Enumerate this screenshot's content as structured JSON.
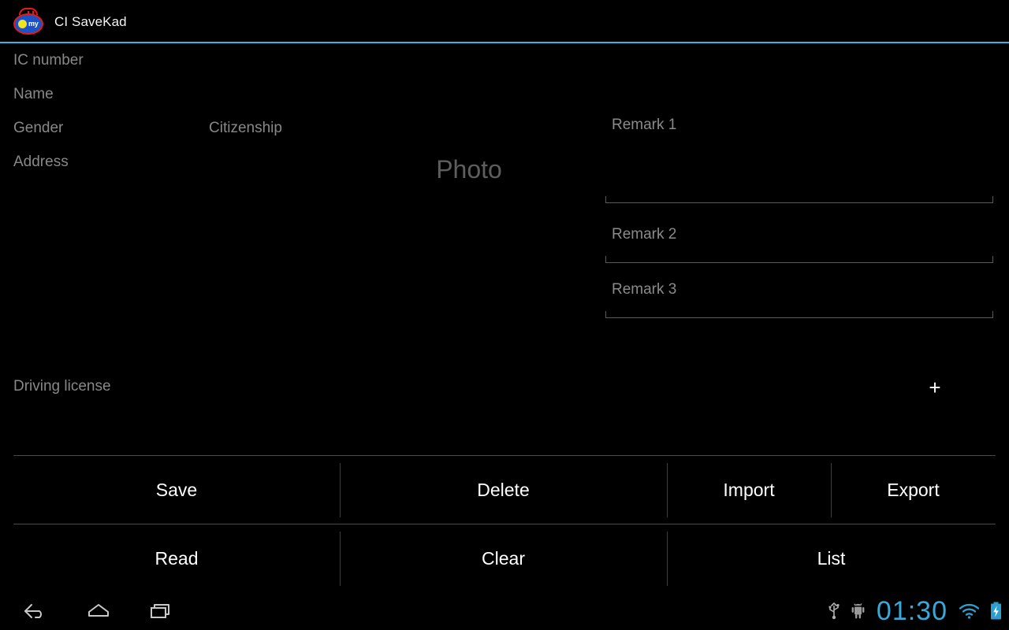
{
  "app": {
    "title": "CI SaveKad",
    "icon_name": "my-kad-logo-icon",
    "icon_badge_text": "my",
    "accent_color": "#33b5e5"
  },
  "form": {
    "ic_number_placeholder": "IC number",
    "name_placeholder": "Name",
    "gender_placeholder": "Gender",
    "citizenship_placeholder": "Citizenship",
    "address_placeholder": "Address",
    "photo_placeholder": "Photo",
    "remarks": [
      {
        "placeholder": "Remark 1",
        "value": ""
      },
      {
        "placeholder": "Remark 2",
        "value": ""
      },
      {
        "placeholder": "Remark 3",
        "value": ""
      }
    ]
  },
  "driving_license": {
    "label": "Driving license",
    "add_label": "+",
    "add_icon": "plus-icon"
  },
  "buttons": {
    "row1": [
      {
        "label": "Save"
      },
      {
        "label": "Delete"
      },
      {
        "label": "Import"
      },
      {
        "label": "Export"
      }
    ],
    "row2": [
      {
        "label": "Read"
      },
      {
        "label": "Clear"
      },
      {
        "label": "List"
      }
    ]
  },
  "navbar": {
    "back_icon": "back-arrow-icon",
    "home_icon": "home-icon",
    "recents_icon": "recent-apps-icon"
  },
  "statusbar": {
    "clock": "01:30",
    "clock_color": "#3aa8d8",
    "icons": [
      {
        "name": "usb-icon"
      },
      {
        "name": "android-debug-icon"
      },
      {
        "name": "wifi-icon"
      },
      {
        "name": "battery-charging-icon"
      }
    ]
  }
}
